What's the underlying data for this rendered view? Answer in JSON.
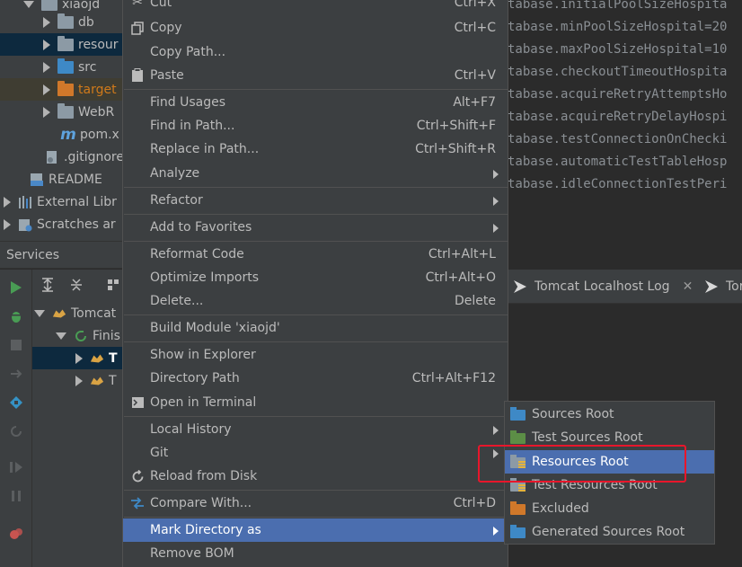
{
  "project_tree": {
    "items": [
      {
        "label": "xiaojd",
        "icon": "folder-icon",
        "color": "#8c9aa5"
      },
      {
        "label": "db",
        "icon": "folder-icon",
        "color": "#8c9aa5"
      },
      {
        "label": "resour",
        "icon": "folder-icon",
        "color": "#8c9aa5"
      },
      {
        "label": "src",
        "icon": "source-folder-icon",
        "color": "#3e89c6"
      },
      {
        "label": "target",
        "icon": "excluded-folder-icon",
        "color": "#d0782a"
      },
      {
        "label": "WebR",
        "icon": "web-folder-icon",
        "color": "#8c9aa5"
      },
      {
        "label": "pom.x",
        "icon": "maven-icon",
        "glyph": "m"
      },
      {
        "label": ".gitignore",
        "icon": "gitignore-file-icon"
      },
      {
        "label": "README",
        "icon": "markdown-file-icon"
      },
      {
        "label": "External Libr",
        "icon": "libraries-icon"
      },
      {
        "label": "Scratches ar",
        "icon": "scratches-icon"
      }
    ]
  },
  "editor": {
    "lines": [
      "tabase.initialPoolSizeHospita",
      "tabase.minPoolSizeHospital=20",
      "tabase.maxPoolSizeHospital=10",
      "tabase.checkoutTimeoutHospita",
      "tabase.acquireRetryAttemptsHo",
      "tabase.acquireRetryDelayHospi",
      "tabase.testConnectionOnChecki",
      "tabase.automaticTestTableHosp",
      "tabase.idleConnectionTestPeri"
    ]
  },
  "services": {
    "title": "Services",
    "tree": [
      {
        "label": "Tomcat",
        "icon": "tomcat-icon"
      },
      {
        "label": "Finis",
        "icon": "refresh-icon"
      },
      {
        "label": "T",
        "icon": "tomcat-icon"
      },
      {
        "label": "T",
        "icon": "tomcat-icon"
      }
    ],
    "tabs": [
      {
        "label": "Tomcat Localhost Log"
      },
      {
        "label": "Tor"
      }
    ]
  },
  "context_menu": {
    "items": [
      {
        "label": "Cut",
        "shortcut": "Ctrl+X",
        "icon": "scissors-icon"
      },
      {
        "label": "Copy",
        "shortcut": "Ctrl+C",
        "icon": "copy-icon"
      },
      {
        "label": "Copy Path...",
        "shortcut": ""
      },
      {
        "label": "Paste",
        "shortcut": "Ctrl+V",
        "icon": "paste-icon"
      },
      {
        "label": "Find Usages",
        "shortcut": "Alt+F7"
      },
      {
        "label": "Find in Path...",
        "shortcut": "Ctrl+Shift+F"
      },
      {
        "label": "Replace in Path...",
        "shortcut": "Ctrl+Shift+R"
      },
      {
        "label": "Analyze",
        "shortcut": "",
        "submenu": true
      },
      {
        "label": "Refactor",
        "shortcut": "",
        "submenu": true
      },
      {
        "label": "Add to Favorites",
        "shortcut": "",
        "submenu": true
      },
      {
        "label": "Reformat Code",
        "shortcut": "Ctrl+Alt+L"
      },
      {
        "label": "Optimize Imports",
        "shortcut": "Ctrl+Alt+O"
      },
      {
        "label": "Delete...",
        "shortcut": "Delete"
      },
      {
        "label": "Build Module 'xiaojd'",
        "shortcut": ""
      },
      {
        "label": "Show in Explorer",
        "shortcut": ""
      },
      {
        "label": "Directory Path",
        "shortcut": "Ctrl+Alt+F12"
      },
      {
        "label": "Open in Terminal",
        "shortcut": "",
        "icon": "terminal-icon"
      },
      {
        "label": "Local History",
        "shortcut": "",
        "submenu": true
      },
      {
        "label": "Git",
        "shortcut": "",
        "submenu": true
      },
      {
        "label": "Reload from Disk",
        "shortcut": "",
        "icon": "reload-icon"
      },
      {
        "label": "Compare With...",
        "shortcut": "Ctrl+D",
        "icon": "compare-icon"
      },
      {
        "label": "Mark Directory as",
        "shortcut": "",
        "submenu": true,
        "highlighted": true
      },
      {
        "label": "Remove BOM",
        "shortcut": ""
      }
    ]
  },
  "submenu": {
    "items": [
      {
        "label": "Sources Root",
        "icon": "sources-root-icon",
        "color": "#3e89c6"
      },
      {
        "label": "Test Sources Root",
        "icon": "test-sources-root-icon",
        "color": "#5c8e46"
      },
      {
        "label": "Resources Root",
        "icon": "resources-root-icon",
        "color": "#8c9aa5",
        "highlighted": true
      },
      {
        "label": "Test Resources Root",
        "icon": "test-resources-root-icon",
        "color": "#8c9aa5"
      },
      {
        "label": "Excluded",
        "icon": "excluded-folder-icon",
        "color": "#d0782a"
      },
      {
        "label": "Generated Sources Root",
        "icon": "generated-sources-root-icon",
        "color": "#3e89c6"
      }
    ]
  },
  "colors": {
    "highlight": "#4b6eaf",
    "annotation_box": "#e8162b",
    "panel": "#3c3f41",
    "editor_bg": "#2b2b2b"
  }
}
